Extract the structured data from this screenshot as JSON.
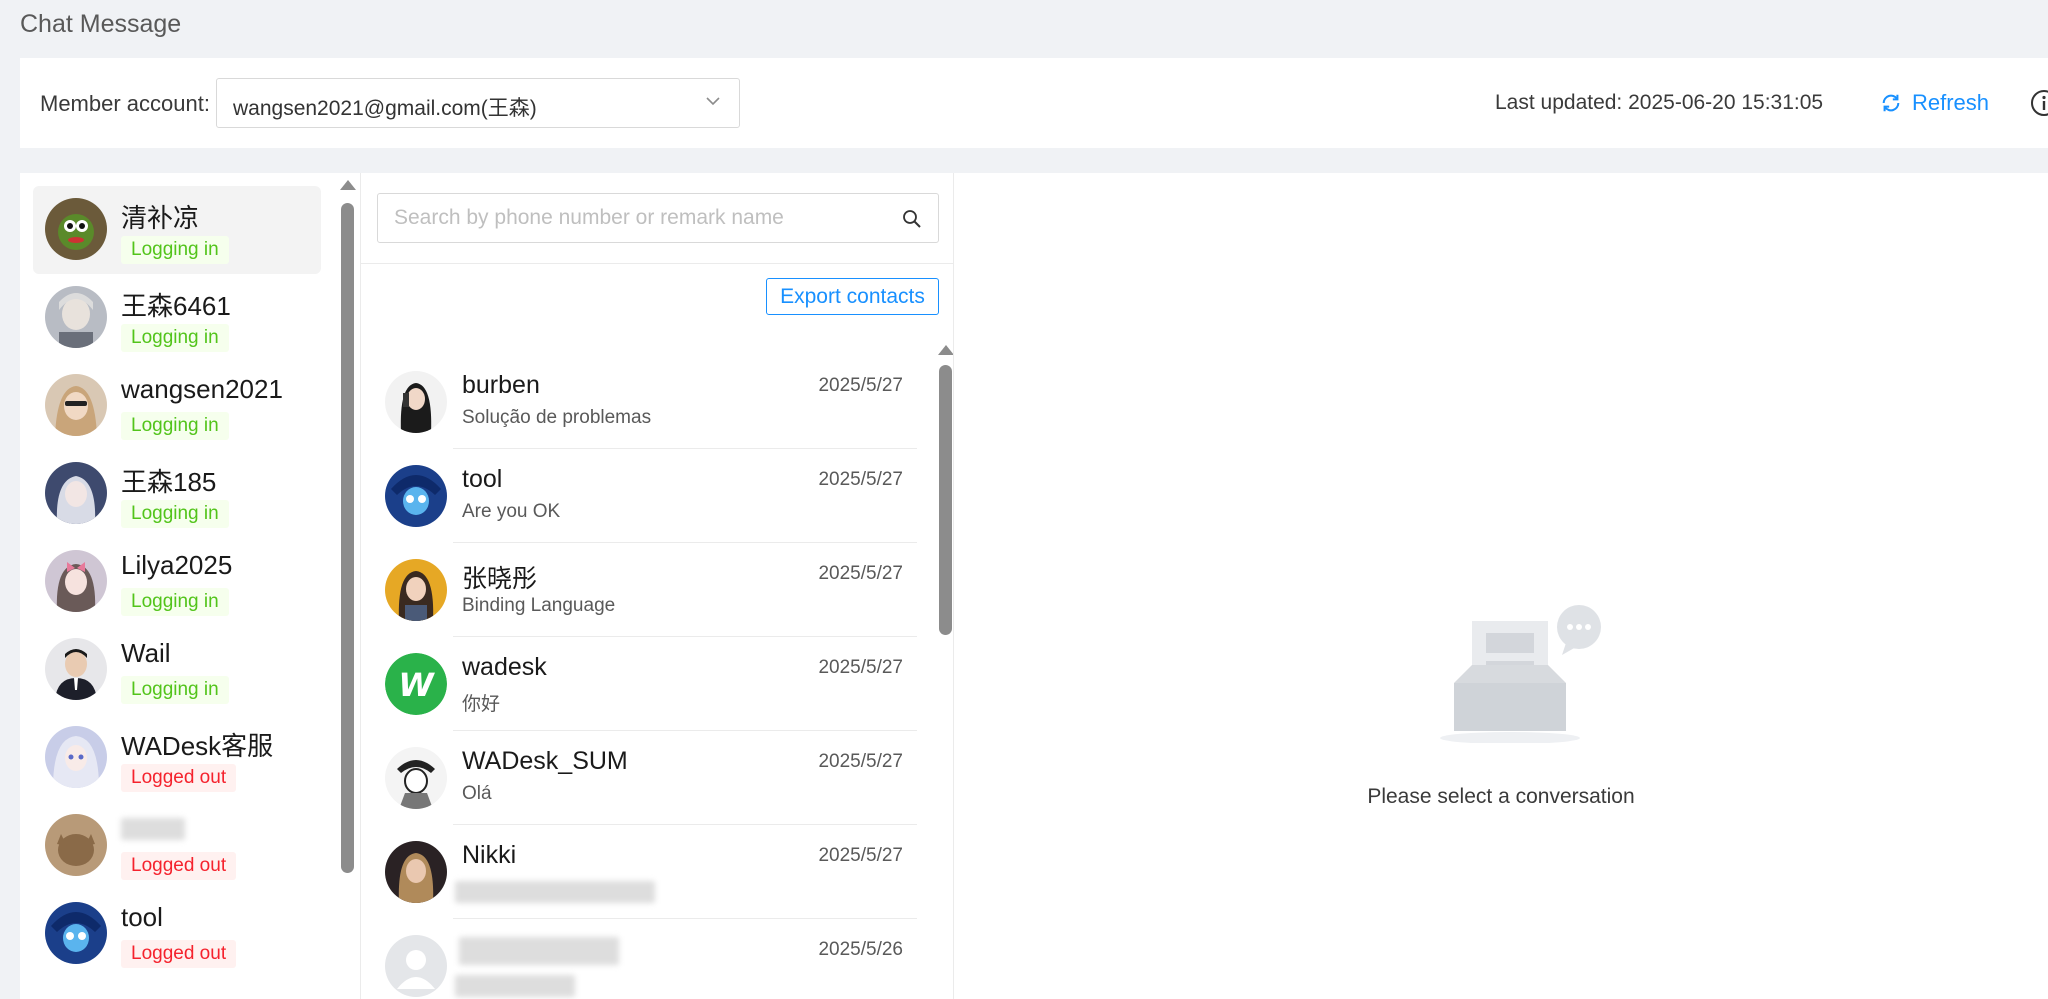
{
  "page": {
    "title": "Chat Message"
  },
  "topbar": {
    "member_label": "Member account:",
    "member_value": "wangsen2021@gmail.com(王森)",
    "last_updated": "Last updated: 2025-06-20 15:31:05",
    "refresh_label": "Refresh"
  },
  "accounts": [
    {
      "name": "清补凉",
      "status": "Logging in",
      "state": "in",
      "active": true
    },
    {
      "name": "王森6461",
      "status": "Logging in",
      "state": "in"
    },
    {
      "name": "wangsen2021",
      "status": "Logging in",
      "state": "in"
    },
    {
      "name": "王森185",
      "status": "Logging in",
      "state": "in"
    },
    {
      "name": "Lilya2025",
      "status": "Logging in",
      "state": "in"
    },
    {
      "name": "Wail",
      "status": "Logging in",
      "state": "in"
    },
    {
      "name": "WADesk客服",
      "status": "Logged out",
      "state": "out"
    },
    {
      "name": "",
      "status": "Logged out",
      "state": "out"
    },
    {
      "name": "tool",
      "status": "Logged out",
      "state": "out"
    }
  ],
  "contacts_panel": {
    "search_placeholder": "Search by phone number or remark name",
    "export_label": "Export contacts"
  },
  "contacts": [
    {
      "name": "burben",
      "preview": "Solução de problemas",
      "date": "2025/5/27"
    },
    {
      "name": "tool",
      "preview": "Are you OK",
      "date": "2025/5/27"
    },
    {
      "name": "张晓彤",
      "preview": "Binding Language",
      "date": "2025/5/27"
    },
    {
      "name": "wadesk",
      "preview": "你好",
      "date": "2025/5/27"
    },
    {
      "name": "WADesk_SUM",
      "preview": "Olá",
      "date": "2025/5/27"
    },
    {
      "name": "Nikki",
      "preview": "",
      "date": "2025/5/27"
    },
    {
      "name": "",
      "preview": "",
      "date": "2025/5/26"
    }
  ],
  "chat": {
    "empty_text": "Please select a conversation"
  },
  "colors": {
    "accent": "#1890ff",
    "online": "#52c41a",
    "offline": "#f5222d"
  }
}
